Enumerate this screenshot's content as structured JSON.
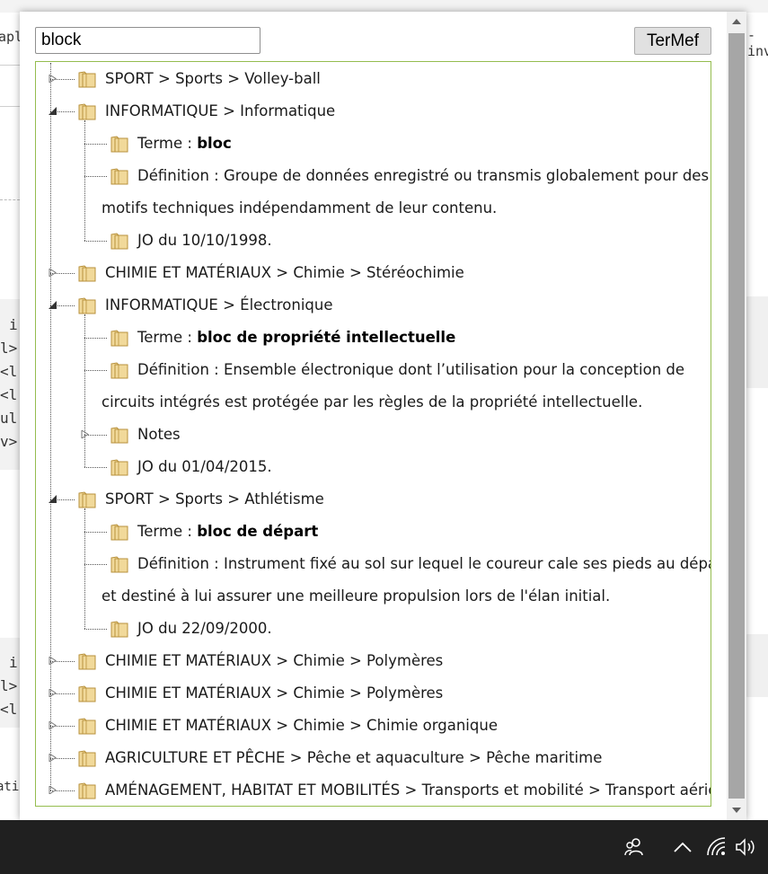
{
  "background_page": {
    "partial_text_left": [
      "apli",
      "i",
      "l>",
      "<l",
      "<l",
      "ul",
      "v>",
      "i",
      "l>",
      "<l",
      "atio"
    ],
    "partial_text_right": "-inv"
  },
  "popup": {
    "search": {
      "value": "block",
      "placeholder": ""
    },
    "termef_button_label": "TerMef",
    "tree": [
      {
        "label": "SPORT > Sports > Volley-ball",
        "expanded": false
      },
      {
        "label": "INFORMATIQUE > Informatique",
        "expanded": true,
        "children": [
          {
            "kind": "terme",
            "prefix": "Terme : ",
            "value": "bloc"
          },
          {
            "kind": "definition",
            "line1": "Définition : Groupe de données enregistré ou transmis globalement pour des",
            "line2": "motifs techniques indépendamment de leur contenu."
          },
          {
            "kind": "jo",
            "label": "JO du 10/10/1998."
          }
        ]
      },
      {
        "label": "CHIMIE ET MATÉRIAUX > Chimie > Stéréochimie",
        "expanded": false
      },
      {
        "label": "INFORMATIQUE > Électronique",
        "expanded": true,
        "children": [
          {
            "kind": "terme",
            "prefix": "Terme : ",
            "value": "bloc de propriété intellectuelle"
          },
          {
            "kind": "definition",
            "line1": "Définition : Ensemble électronique dont l’utilisation pour la conception de",
            "line2": "circuits intégrés est protégée par les règles de la propriété intellectuelle."
          },
          {
            "kind": "notes",
            "label": "Notes"
          },
          {
            "kind": "jo",
            "label": "JO du 01/04/2015."
          }
        ]
      },
      {
        "label": "SPORT > Sports > Athlétisme",
        "expanded": true,
        "children": [
          {
            "kind": "terme",
            "prefix": "Terme : ",
            "value": "bloc de départ"
          },
          {
            "kind": "definition",
            "line1": "Définition : Instrument fixé au sol sur lequel le coureur cale ses pieds au départ,",
            "line2": "et destiné à lui assurer une meilleure propulsion lors de l'élan initial."
          },
          {
            "kind": "jo",
            "label": "JO du 22/09/2000."
          }
        ]
      },
      {
        "label": "CHIMIE ET MATÉRIAUX > Chimie > Polymères",
        "expanded": false
      },
      {
        "label": "CHIMIE ET MATÉRIAUX > Chimie > Polymères",
        "expanded": false
      },
      {
        "label": "CHIMIE ET MATÉRIAUX > Chimie > Chimie organique",
        "expanded": false
      },
      {
        "label": "AGRICULTURE ET PÊCHE > Pêche et aquaculture > Pêche maritime",
        "expanded": false
      },
      {
        "label": "AMÉNAGEMENT, HABITAT ET MOBILITÉS > Transports et mobilité > Transport aérien",
        "expanded": false
      }
    ]
  },
  "taskbar": {
    "icons": [
      "people-icon",
      "chevron-up-icon",
      "wifi-icon",
      "volume-icon"
    ]
  },
  "colors": {
    "tree_border": "#95bd4f",
    "folder_fill": "#f1d99a",
    "folder_stroke": "#b8913c",
    "taskbar": "#202020"
  }
}
